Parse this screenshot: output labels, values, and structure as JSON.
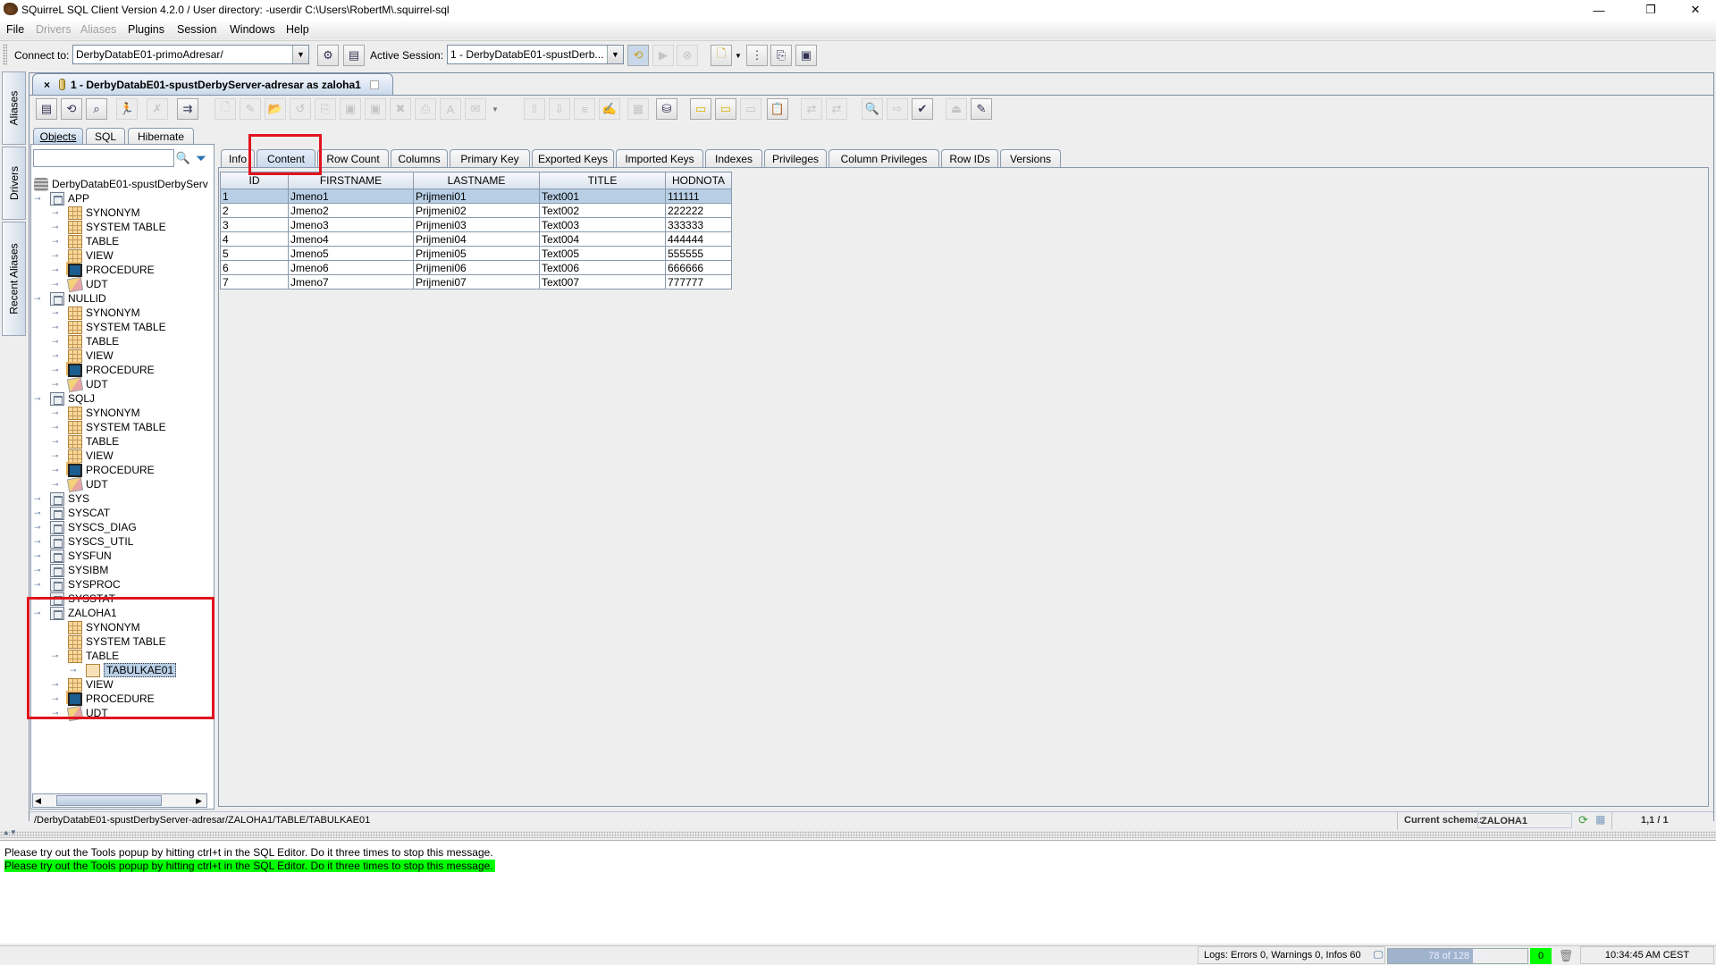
{
  "window": {
    "title": "SQuirreL SQL Client Version 4.2.0 / User directory: -userdir C:\\Users\\RobertM\\.squirrel-sql",
    "controls": {
      "minimize": "—",
      "restore": "❐",
      "close": "✕"
    }
  },
  "menubar": {
    "items": [
      {
        "label": "File",
        "enabled": true
      },
      {
        "label": "Drivers",
        "enabled": false
      },
      {
        "label": "Aliases",
        "enabled": false
      },
      {
        "label": "Plugins",
        "enabled": true
      },
      {
        "label": "Session",
        "enabled": true
      },
      {
        "label": "Windows",
        "enabled": true
      },
      {
        "label": "Help",
        "enabled": true
      }
    ]
  },
  "toolbar": {
    "connect_label": "Connect to:",
    "connect_value": "DerbyDatabE01-primoAdresar/",
    "active_session_label": "Active Session:",
    "active_session_value": "1 - DerbyDatabE01-spustDerb..."
  },
  "side_tabs": [
    "Aliases",
    "Drivers",
    "Recent Aliases"
  ],
  "session_tab": {
    "close": "×",
    "title": "1 - DerbyDatabE01-spustDerbyServer-adresar  as zaloha1"
  },
  "left_tabs": [
    {
      "label": "Objects",
      "selected": true
    },
    {
      "label": "SQL",
      "selected": false
    },
    {
      "label": "Hibernate",
      "selected": false
    }
  ],
  "filter": {
    "value": ""
  },
  "tree": {
    "root": "DerbyDatabE01-spustDerbyServ",
    "nodes": [
      {
        "label": "APP",
        "type": "schema",
        "level": 1,
        "expanded": true
      },
      {
        "label": "SYNONYM",
        "type": "table",
        "level": 2
      },
      {
        "label": "SYSTEM TABLE",
        "type": "table",
        "level": 2
      },
      {
        "label": "TABLE",
        "type": "table",
        "level": 2
      },
      {
        "label": "VIEW",
        "type": "table",
        "level": 2
      },
      {
        "label": "PROCEDURE",
        "type": "proc",
        "level": 2
      },
      {
        "label": "UDT",
        "type": "udt",
        "level": 2
      },
      {
        "label": "NULLID",
        "type": "schema",
        "level": 1,
        "expanded": true
      },
      {
        "label": "SYNONYM",
        "type": "table",
        "level": 2
      },
      {
        "label": "SYSTEM TABLE",
        "type": "table",
        "level": 2
      },
      {
        "label": "TABLE",
        "type": "table",
        "level": 2
      },
      {
        "label": "VIEW",
        "type": "table",
        "level": 2
      },
      {
        "label": "PROCEDURE",
        "type": "proc",
        "level": 2
      },
      {
        "label": "UDT",
        "type": "udt",
        "level": 2
      },
      {
        "label": "SQLJ",
        "type": "schema",
        "level": 1,
        "expanded": true
      },
      {
        "label": "SYNONYM",
        "type": "table",
        "level": 2
      },
      {
        "label": "SYSTEM TABLE",
        "type": "table",
        "level": 2
      },
      {
        "label": "TABLE",
        "type": "table",
        "level": 2
      },
      {
        "label": "VIEW",
        "type": "table",
        "level": 2
      },
      {
        "label": "PROCEDURE",
        "type": "proc",
        "level": 2
      },
      {
        "label": "UDT",
        "type": "udt",
        "level": 2
      },
      {
        "label": "SYS",
        "type": "schema",
        "level": 1
      },
      {
        "label": "SYSCAT",
        "type": "schema",
        "level": 1
      },
      {
        "label": "SYSCS_DIAG",
        "type": "schema",
        "level": 1
      },
      {
        "label": "SYSCS_UTIL",
        "type": "schema",
        "level": 1
      },
      {
        "label": "SYSFUN",
        "type": "schema",
        "level": 1
      },
      {
        "label": "SYSIBM",
        "type": "schema",
        "level": 1
      },
      {
        "label": "SYSPROC",
        "type": "schema",
        "level": 1
      },
      {
        "label": "SYSSTAT",
        "type": "schema",
        "level": 1
      },
      {
        "label": "ZALOHA1",
        "type": "schema",
        "level": 1,
        "expanded": true
      },
      {
        "label": "SYNONYM",
        "type": "table",
        "level": 2,
        "leaf": true
      },
      {
        "label": "SYSTEM TABLE",
        "type": "table",
        "level": 2,
        "leaf": true
      },
      {
        "label": "TABLE",
        "type": "table",
        "level": 2,
        "expanded": true
      },
      {
        "label": "TABULKAE01",
        "type": "tbl",
        "level": 3,
        "selected": true
      },
      {
        "label": "VIEW",
        "type": "table",
        "level": 2
      },
      {
        "label": "PROCEDURE",
        "type": "proc",
        "level": 2
      },
      {
        "label": "UDT",
        "type": "udt",
        "level": 2
      }
    ]
  },
  "content_tabs": [
    {
      "label": "Info",
      "selected": false
    },
    {
      "label": "Content",
      "selected": true
    },
    {
      "label": "Row Count",
      "selected": false
    },
    {
      "label": "Columns",
      "selected": false
    },
    {
      "label": "Primary Key",
      "selected": false
    },
    {
      "label": "Exported Keys",
      "selected": false
    },
    {
      "label": "Imported Keys",
      "selected": false
    },
    {
      "label": "Indexes",
      "selected": false
    },
    {
      "label": "Privileges",
      "selected": false
    },
    {
      "label": "Column Privileges",
      "selected": false
    },
    {
      "label": "Row IDs",
      "selected": false
    },
    {
      "label": "Versions",
      "selected": false
    }
  ],
  "table": {
    "columns": [
      "ID",
      "FIRSTNAME",
      "LASTNAME",
      "TITLE",
      "HODNOTA"
    ],
    "rows": [
      [
        "1",
        "Jmeno1",
        "Prijmeni01",
        "Text001",
        "111111"
      ],
      [
        "2",
        "Jmeno2",
        "Prijmeni02",
        "Text002",
        "222222"
      ],
      [
        "3",
        "Jmeno3",
        "Prijmeni03",
        "Text003",
        "333333"
      ],
      [
        "4",
        "Jmeno4",
        "Prijmeni04",
        "Text004",
        "444444"
      ],
      [
        "5",
        "Jmeno5",
        "Prijmeni05",
        "Text005",
        "555555"
      ],
      [
        "6",
        "Jmeno6",
        "Prijmeni06",
        "Text006",
        "666666"
      ],
      [
        "7",
        "Jmeno7",
        "Prijmeni07",
        "Text007",
        "777777"
      ]
    ],
    "selected_row": 0
  },
  "path_bar": {
    "path": "/DerbyDatabE01-spustDerbyServer-adresar/ZALOHA1/TABLE/TABULKAE01",
    "schema_label": "Current schema:",
    "schema_value": "ZALOHA1",
    "position": "1,1 / 1"
  },
  "messages": [
    {
      "text": "Please try out the Tools popup by hitting ctrl+t in the SQL Editor. Do it three times to stop this message.",
      "highlight": false
    },
    {
      "text": "Please try out the Tools popup by hitting ctrl+t in the SQL Editor. Do it three times to stop this message.",
      "highlight": true
    }
  ],
  "status_bar": {
    "logs": "Logs: Errors 0, Warnings 0, Infos 60",
    "memory": "78 of 128 MB",
    "memory_used_fraction": 0.61,
    "counter": "0",
    "clock": "10:34:45 AM CEST"
  },
  "colors": {
    "highlight_red": "#e0141e",
    "message_green": "#00ff00",
    "selection_blue": "#b8cfe5"
  }
}
